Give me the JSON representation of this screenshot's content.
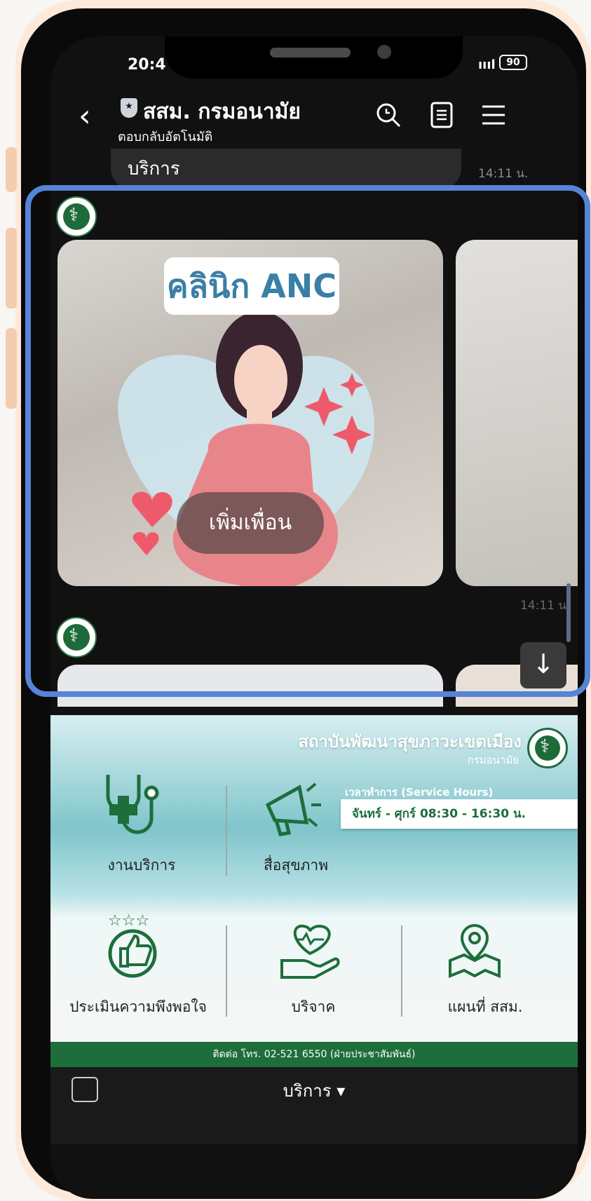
{
  "status": {
    "time": "20:4",
    "signal": "ıııl",
    "battery": "90"
  },
  "header": {
    "back": "‹",
    "title": "สสม. กรมอนามัย",
    "subtitle": "ตอบกลับอัตโนมัติ"
  },
  "messages": {
    "top_bubble": "บริการ",
    "top_time": "14:11 น.",
    "card_label": "คลินิก ANC",
    "card_button": "เพิ่มเพื่อน",
    "card_time": "14:11 น"
  },
  "rich_menu": {
    "org_name": "สถาบันพัฒนาสุขภาวะเขตเมือง",
    "org_sub": "กรมอนามัย",
    "hours_label": "เวลาทำการ (Service Hours)",
    "hours_value": "จันทร์ - ศุกร์  08:30 - 16:30 น.",
    "items": [
      {
        "label": "งานบริการ",
        "icon": "stethoscope-icon"
      },
      {
        "label": "สื่อสุขภาพ",
        "icon": "megaphone-icon"
      },
      {
        "label": "ประเมินความพึงพอใจ",
        "icon": "thumbs-up-icon"
      },
      {
        "label": "บริจาค",
        "icon": "heart-hand-icon"
      },
      {
        "label": "แผนที่ สสม.",
        "icon": "map-pin-icon"
      }
    ],
    "contact": "ติดต่อ โทร. 02-521 6550 (ฝ่ายประชาสัมพันธ์)"
  },
  "bottom_bar": {
    "label": "บริการ ▾"
  },
  "colors": {
    "highlight": "#5684d6",
    "brand_green": "#1d6e3b"
  }
}
